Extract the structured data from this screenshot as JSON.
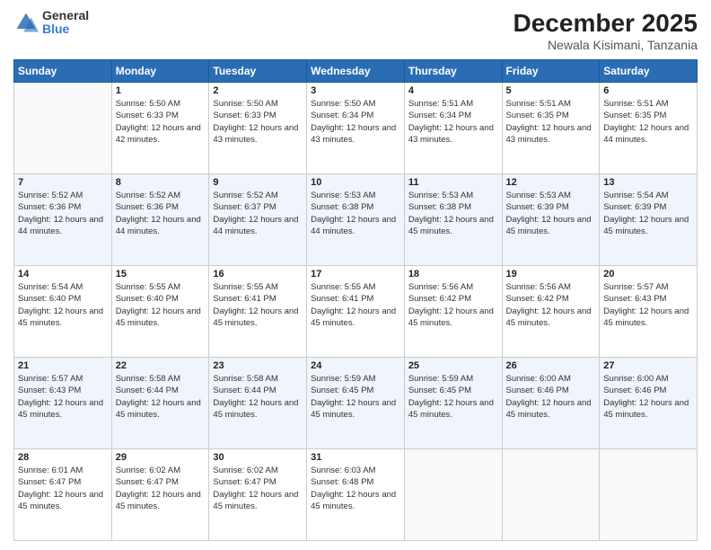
{
  "logo": {
    "general": "General",
    "blue": "Blue"
  },
  "header": {
    "title": "December 2025",
    "subtitle": "Newala Kisimani, Tanzania"
  },
  "weekdays": [
    "Sunday",
    "Monday",
    "Tuesday",
    "Wednesday",
    "Thursday",
    "Friday",
    "Saturday"
  ],
  "weeks": [
    [
      {
        "day": "",
        "sunrise": "",
        "sunset": "",
        "daylight": ""
      },
      {
        "day": "1",
        "sunrise": "Sunrise: 5:50 AM",
        "sunset": "Sunset: 6:33 PM",
        "daylight": "Daylight: 12 hours and 42 minutes."
      },
      {
        "day": "2",
        "sunrise": "Sunrise: 5:50 AM",
        "sunset": "Sunset: 6:33 PM",
        "daylight": "Daylight: 12 hours and 43 minutes."
      },
      {
        "day": "3",
        "sunrise": "Sunrise: 5:50 AM",
        "sunset": "Sunset: 6:34 PM",
        "daylight": "Daylight: 12 hours and 43 minutes."
      },
      {
        "day": "4",
        "sunrise": "Sunrise: 5:51 AM",
        "sunset": "Sunset: 6:34 PM",
        "daylight": "Daylight: 12 hours and 43 minutes."
      },
      {
        "day": "5",
        "sunrise": "Sunrise: 5:51 AM",
        "sunset": "Sunset: 6:35 PM",
        "daylight": "Daylight: 12 hours and 43 minutes."
      },
      {
        "day": "6",
        "sunrise": "Sunrise: 5:51 AM",
        "sunset": "Sunset: 6:35 PM",
        "daylight": "Daylight: 12 hours and 44 minutes."
      }
    ],
    [
      {
        "day": "7",
        "sunrise": "Sunrise: 5:52 AM",
        "sunset": "Sunset: 6:36 PM",
        "daylight": "Daylight: 12 hours and 44 minutes."
      },
      {
        "day": "8",
        "sunrise": "Sunrise: 5:52 AM",
        "sunset": "Sunset: 6:36 PM",
        "daylight": "Daylight: 12 hours and 44 minutes."
      },
      {
        "day": "9",
        "sunrise": "Sunrise: 5:52 AM",
        "sunset": "Sunset: 6:37 PM",
        "daylight": "Daylight: 12 hours and 44 minutes."
      },
      {
        "day": "10",
        "sunrise": "Sunrise: 5:53 AM",
        "sunset": "Sunset: 6:38 PM",
        "daylight": "Daylight: 12 hours and 44 minutes."
      },
      {
        "day": "11",
        "sunrise": "Sunrise: 5:53 AM",
        "sunset": "Sunset: 6:38 PM",
        "daylight": "Daylight: 12 hours and 45 minutes."
      },
      {
        "day": "12",
        "sunrise": "Sunrise: 5:53 AM",
        "sunset": "Sunset: 6:39 PM",
        "daylight": "Daylight: 12 hours and 45 minutes."
      },
      {
        "day": "13",
        "sunrise": "Sunrise: 5:54 AM",
        "sunset": "Sunset: 6:39 PM",
        "daylight": "Daylight: 12 hours and 45 minutes."
      }
    ],
    [
      {
        "day": "14",
        "sunrise": "Sunrise: 5:54 AM",
        "sunset": "Sunset: 6:40 PM",
        "daylight": "Daylight: 12 hours and 45 minutes."
      },
      {
        "day": "15",
        "sunrise": "Sunrise: 5:55 AM",
        "sunset": "Sunset: 6:40 PM",
        "daylight": "Daylight: 12 hours and 45 minutes."
      },
      {
        "day": "16",
        "sunrise": "Sunrise: 5:55 AM",
        "sunset": "Sunset: 6:41 PM",
        "daylight": "Daylight: 12 hours and 45 minutes."
      },
      {
        "day": "17",
        "sunrise": "Sunrise: 5:55 AM",
        "sunset": "Sunset: 6:41 PM",
        "daylight": "Daylight: 12 hours and 45 minutes."
      },
      {
        "day": "18",
        "sunrise": "Sunrise: 5:56 AM",
        "sunset": "Sunset: 6:42 PM",
        "daylight": "Daylight: 12 hours and 45 minutes."
      },
      {
        "day": "19",
        "sunrise": "Sunrise: 5:56 AM",
        "sunset": "Sunset: 6:42 PM",
        "daylight": "Daylight: 12 hours and 45 minutes."
      },
      {
        "day": "20",
        "sunrise": "Sunrise: 5:57 AM",
        "sunset": "Sunset: 6:43 PM",
        "daylight": "Daylight: 12 hours and 45 minutes."
      }
    ],
    [
      {
        "day": "21",
        "sunrise": "Sunrise: 5:57 AM",
        "sunset": "Sunset: 6:43 PM",
        "daylight": "Daylight: 12 hours and 45 minutes."
      },
      {
        "day": "22",
        "sunrise": "Sunrise: 5:58 AM",
        "sunset": "Sunset: 6:44 PM",
        "daylight": "Daylight: 12 hours and 45 minutes."
      },
      {
        "day": "23",
        "sunrise": "Sunrise: 5:58 AM",
        "sunset": "Sunset: 6:44 PM",
        "daylight": "Daylight: 12 hours and 45 minutes."
      },
      {
        "day": "24",
        "sunrise": "Sunrise: 5:59 AM",
        "sunset": "Sunset: 6:45 PM",
        "daylight": "Daylight: 12 hours and 45 minutes."
      },
      {
        "day": "25",
        "sunrise": "Sunrise: 5:59 AM",
        "sunset": "Sunset: 6:45 PM",
        "daylight": "Daylight: 12 hours and 45 minutes."
      },
      {
        "day": "26",
        "sunrise": "Sunrise: 6:00 AM",
        "sunset": "Sunset: 6:46 PM",
        "daylight": "Daylight: 12 hours and 45 minutes."
      },
      {
        "day": "27",
        "sunrise": "Sunrise: 6:00 AM",
        "sunset": "Sunset: 6:46 PM",
        "daylight": "Daylight: 12 hours and 45 minutes."
      }
    ],
    [
      {
        "day": "28",
        "sunrise": "Sunrise: 6:01 AM",
        "sunset": "Sunset: 6:47 PM",
        "daylight": "Daylight: 12 hours and 45 minutes."
      },
      {
        "day": "29",
        "sunrise": "Sunrise: 6:02 AM",
        "sunset": "Sunset: 6:47 PM",
        "daylight": "Daylight: 12 hours and 45 minutes."
      },
      {
        "day": "30",
        "sunrise": "Sunrise: 6:02 AM",
        "sunset": "Sunset: 6:47 PM",
        "daylight": "Daylight: 12 hours and 45 minutes."
      },
      {
        "day": "31",
        "sunrise": "Sunrise: 6:03 AM",
        "sunset": "Sunset: 6:48 PM",
        "daylight": "Daylight: 12 hours and 45 minutes."
      },
      {
        "day": "",
        "sunrise": "",
        "sunset": "",
        "daylight": ""
      },
      {
        "day": "",
        "sunrise": "",
        "sunset": "",
        "daylight": ""
      },
      {
        "day": "",
        "sunrise": "",
        "sunset": "",
        "daylight": ""
      }
    ]
  ]
}
